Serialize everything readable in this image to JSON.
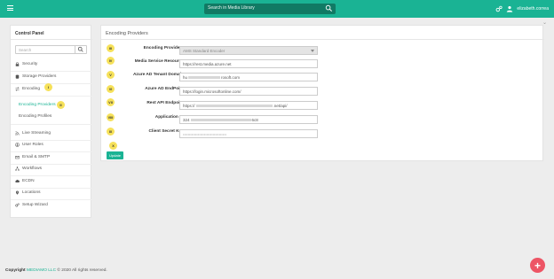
{
  "topbar": {
    "search_placeholder": "Search in Media Library",
    "user_name": "elizabeth.correa"
  },
  "sidebar": {
    "title": "Control Panel",
    "search_placeholder": "Search",
    "items": [
      {
        "label": "Security",
        "icon": "lock-icon"
      },
      {
        "label": "Storage Providers",
        "icon": "database-icon"
      },
      {
        "label": "Encoding",
        "icon": "exchange-icon"
      },
      {
        "label": "Live Streaming",
        "icon": "rss-icon"
      },
      {
        "label": "User Roles",
        "icon": "user-circle-icon"
      },
      {
        "label": "Email & SMTP",
        "icon": "envelope-icon"
      },
      {
        "label": "Workflows",
        "icon": "share-icon"
      },
      {
        "label": "ECDN",
        "icon": "cloud-icon"
      },
      {
        "label": "Locations",
        "icon": "map-marker-icon"
      },
      {
        "label": "Setup Wizard",
        "icon": "cogs-icon"
      }
    ],
    "subitems": [
      {
        "label": "Encoding Providers",
        "active": true
      },
      {
        "label": "Encoding Profiles",
        "active": false
      }
    ],
    "badges": {
      "encoding": "I",
      "encoding_providers": "II"
    }
  },
  "panel": {
    "title": "Encoding Providers",
    "rows": [
      {
        "badge": "III",
        "label": "Encoding Providers",
        "value": "AMS Standard Encoder"
      },
      {
        "badge": "IV",
        "label": "Media Service Resource",
        "value": "https://rest.media.azure.net"
      },
      {
        "badge": "V",
        "label": "Azure AD Tenant Domain",
        "value_start": "hu",
        "value_end": "rosoft.com"
      },
      {
        "badge": "VI",
        "label": "Azure AD EndPoint",
        "value": "https://login.microsoftonline.com/"
      },
      {
        "badge": "VII",
        "label": "Rest API Endpoint",
        "value_start": "https://",
        "value_end": ".net/api/"
      },
      {
        "badge": "VIII",
        "label": "Application ID",
        "value_start": "324",
        "value_end": "6c8"
      },
      {
        "badge": "IX",
        "label": "Client Secret Key",
        "value": "•••••••••••••••••••••••••••••••••••"
      }
    ],
    "update_badge": "X",
    "update_label": "Update"
  },
  "footer": {
    "prefix": "Copyright",
    "brand": "MEDIAMO LLC",
    "suffix": "© 2020 All rights reserved."
  },
  "fab": {
    "label": "+"
  },
  "colors": {
    "accent": "#1ab394",
    "badge": "#f6e15a",
    "fab": "#ed5565"
  }
}
